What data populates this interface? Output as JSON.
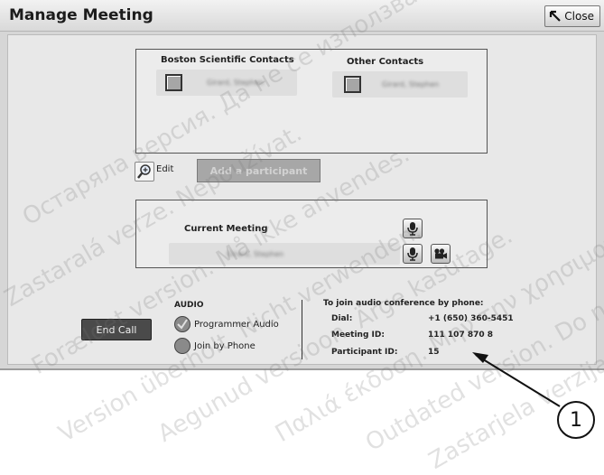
{
  "window": {
    "title": "Manage Meeting",
    "close_label": "Close"
  },
  "contacts": {
    "bsc_label": "Boston Scientific Contacts",
    "bsc_name": "Girard, Stephen",
    "other_label": "Other Contacts",
    "other_name": "Girard, Stephen"
  },
  "actions": {
    "edit_label": "Edit",
    "add_participant_label": "Add a participant"
  },
  "meeting": {
    "current_label": "Current Meeting",
    "participant_name": "Girard, Stephen"
  },
  "end_call_label": "End Call",
  "audio": {
    "heading": "AUDIO",
    "options": [
      {
        "label": "Programmer Audio",
        "selected": true
      },
      {
        "label": "Join by Phone",
        "selected": false
      }
    ]
  },
  "phone": {
    "heading": "To join audio conference by phone:",
    "rows": [
      {
        "key": "Dial:",
        "value": "+1 (650) 360-5451"
      },
      {
        "key": "Meeting ID:",
        "value": "111 107 870 8"
      },
      {
        "key": "Participant ID:",
        "value": "15"
      }
    ]
  },
  "callout": "1",
  "watermarks": [
    "Остаряла версия. Да не се използва.",
    "Zastaralá verze. Nepoužívat.",
    "Forældet version. Må ikke anvendes.",
    "Version überholt. Nicht verwenden.",
    "Aegunud versioon. Ärge kasutage.",
    "Παλιά έκδοση. Μην την χρησιμοποιείτε.",
    "Outdated version. Do not use.",
    "Zastarjela verzija. Nemojte upotrebljavati."
  ],
  "colors": {
    "window_bg": "#d6d6d6",
    "content_bg": "#e8e8e8",
    "end_call_bg": "#4a4a4a",
    "disabled_btn": "#a7a7a7"
  }
}
